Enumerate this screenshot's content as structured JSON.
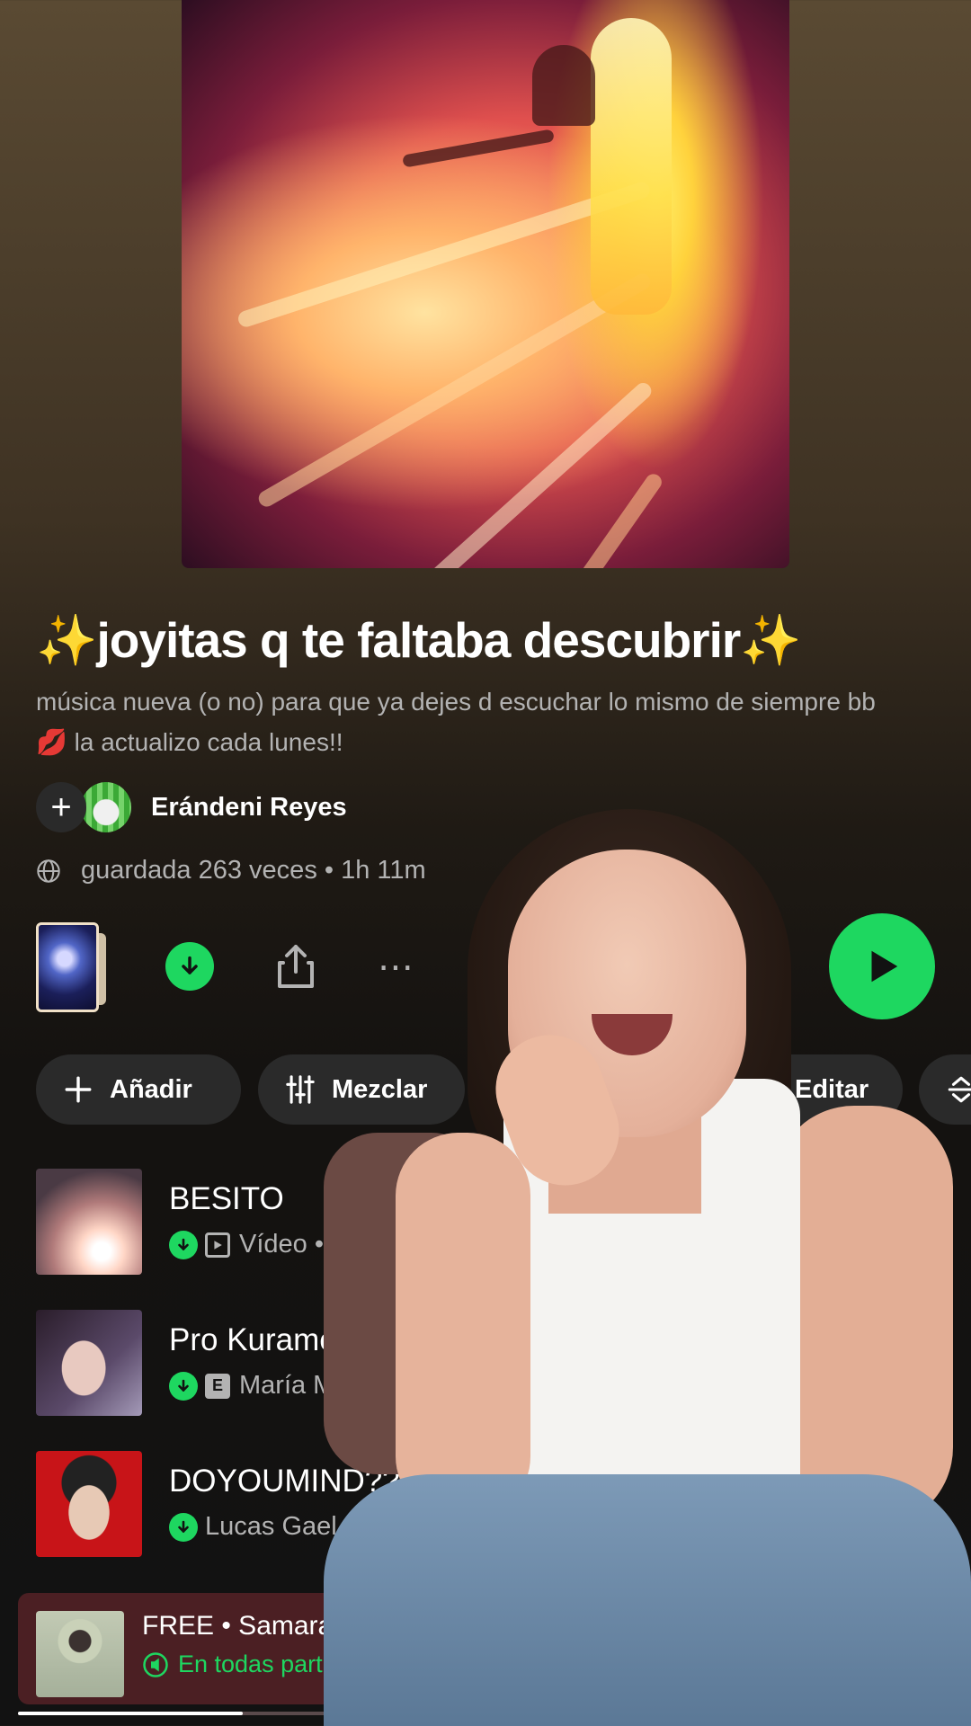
{
  "playlist": {
    "title_spark": "✨",
    "title": "joyitas q te faltaba descubrir",
    "description": "música nueva (o no) para que ya dejes d escuchar lo mismo de siempre bb 💋 la actualizo cada lunes!!",
    "owner": "Erándeni Reyes",
    "meta": "guardada 263 veces • 1h 11m"
  },
  "actions": {
    "more": "⋯"
  },
  "chips": {
    "add": "Añadir",
    "mix": "Mezclar",
    "edit": "Editar"
  },
  "tracks": [
    {
      "title": "BESITO",
      "badge": "video",
      "subtitle": "Vídeo • Ju"
    },
    {
      "title": "Pro Kurame",
      "badge": "explicit",
      "badge_label": "E",
      "subtitle": "María M"
    },
    {
      "title": "DOYOUMIND??",
      "badge": "none",
      "subtitle": "Lucas Gael"
    }
  ],
  "now_playing": {
    "title": "FREE • Samara",
    "device": "En todas part",
    "progress": 0.24
  },
  "colors": {
    "accent": "#1ed760",
    "mini_player_bg": "#4b1f23",
    "secondary_text": "#b3b3b3"
  }
}
